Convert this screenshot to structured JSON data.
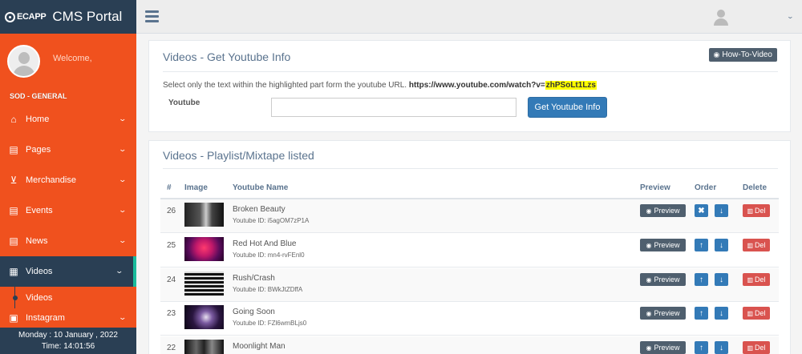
{
  "sidebar": {
    "logo_text": "ECAPP",
    "app_title": "CMS Portal",
    "welcome": "Welcome,",
    "section_label": "SOD - GENERAL",
    "items": [
      {
        "label": "Home",
        "icon": "home-icon"
      },
      {
        "label": "Pages",
        "icon": "file-icon"
      },
      {
        "label": "Merchandise",
        "icon": "cart-icon"
      },
      {
        "label": "Events",
        "icon": "file-icon"
      },
      {
        "label": "News",
        "icon": "file-icon"
      },
      {
        "label": "Videos",
        "icon": "film-icon"
      },
      {
        "label": "Instagram",
        "icon": "instagram-icon"
      }
    ],
    "sub_item": "Videos",
    "date_line": "Monday : 10 January , 2022",
    "time_line": "Time: 14:01:56"
  },
  "youtube_panel": {
    "title": "Videos - Get Youtube Info",
    "howto_label": "How-To-Video",
    "hint_text": "Select only the text within the highlighted part form the youtube URL.",
    "url_prefix": "https://www.youtube.com/watch?v=",
    "url_highlight": "zhPSoLt1Lzs",
    "input_label": "Youtube",
    "input_value": "",
    "button_label": "Get Youtube Info"
  },
  "playlist_panel": {
    "title": "Videos - Playlist/Mixtape listed",
    "headers": {
      "num": "#",
      "image": "Image",
      "name": "Youtube Name",
      "preview": "Preview",
      "order": "Order",
      "delete": "Delete"
    },
    "preview_label": "Preview",
    "delete_label": "Del",
    "rows": [
      {
        "num": "26",
        "name": "Broken Beauty",
        "ytid": "Youtube ID: i5agOM7zP1A"
      },
      {
        "num": "25",
        "name": "Red Hot And Blue",
        "ytid": "Youtube ID: mn4-rvFEnl0"
      },
      {
        "num": "24",
        "name": "Rush/Crash",
        "ytid": "Youtube ID: BWkJtZDffA"
      },
      {
        "num": "23",
        "name": "Going Soon",
        "ytid": "Youtube ID: FZl6wmBLjs0"
      },
      {
        "num": "22",
        "name": "Moonlight Man",
        "ytid": ""
      }
    ]
  },
  "colors": {
    "sidebar_bg": "#f0511e",
    "nav_dark": "#2a3f54",
    "primary": "#337ab7",
    "danger": "#d9534f",
    "highlight": "#ffff00"
  }
}
